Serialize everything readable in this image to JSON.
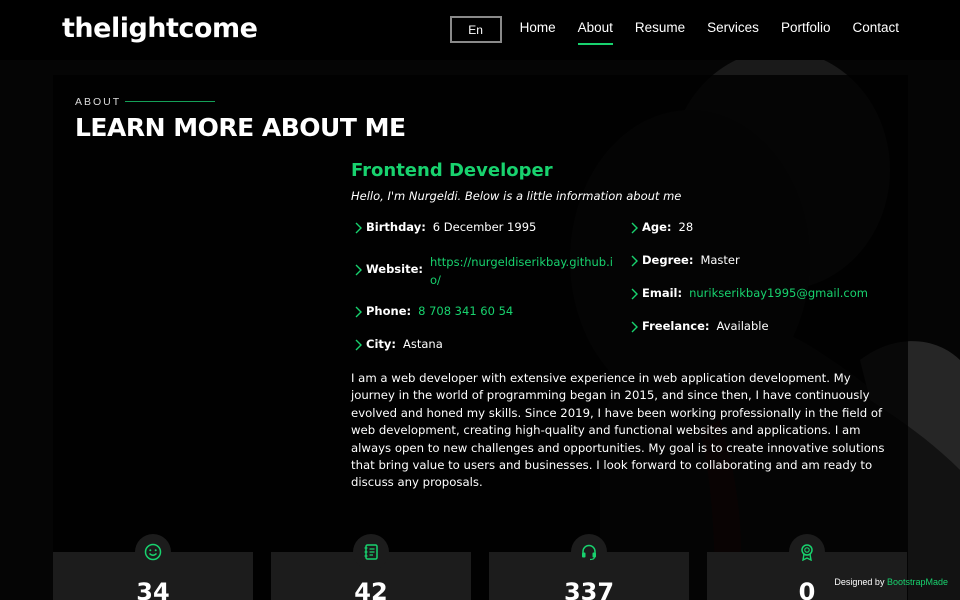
{
  "header": {
    "logo": "thelightcome",
    "language": "En",
    "nav": [
      "Home",
      "About",
      "Resume",
      "Services",
      "Portfolio",
      "Contact"
    ],
    "active_nav": "About"
  },
  "about": {
    "subtitle": "ABOUT",
    "title": "LEARN MORE ABOUT ME",
    "role": "Frontend Developer",
    "intro": "Hello, I'm Nurgeldi. Below is a little information about me",
    "left_info": [
      {
        "label": "Birthday:",
        "value": "6 December 1995"
      },
      {
        "label": "Website:",
        "value_line1": "https://nurgeldiserikbay.github.i",
        "value_line2": "o/"
      },
      {
        "label": "Phone:",
        "value": "8 708 341 60 54"
      },
      {
        "label": "City:",
        "value": "Astana"
      }
    ],
    "right_info": [
      {
        "label": "Age:",
        "value": "28"
      },
      {
        "label": "Degree:",
        "value": "Master"
      },
      {
        "label": "Email:",
        "value": "nurikserikbay1995@gmail.com"
      },
      {
        "label": "Freelance:",
        "value": "Available"
      }
    ],
    "bio": "I am a web developer with extensive experience in web application development. My journey in the world of programming began in 2015, and since then, I have continuously evolved and honed my skills. Since 2019, I have been working professionally in the field of web development, creating high-quality and functional websites and applications. I am always open to new challenges and opportunities. My goal is to create innovative solutions that bring value to users and businesses. I look forward to collaborating and am ready to discuss any proposals."
  },
  "stats": [
    {
      "icon": "smiley-icon",
      "value": "34"
    },
    {
      "icon": "journal-icon",
      "value": "42"
    },
    {
      "icon": "headset-icon",
      "value": "337"
    },
    {
      "icon": "award-icon",
      "value": "0"
    }
  ],
  "credits": {
    "prefix": "Designed by ",
    "brand": "BootstrapMade"
  },
  "colors": {
    "accent": "#18d26e",
    "background": "#040404",
    "card": "#1c1c1c"
  }
}
